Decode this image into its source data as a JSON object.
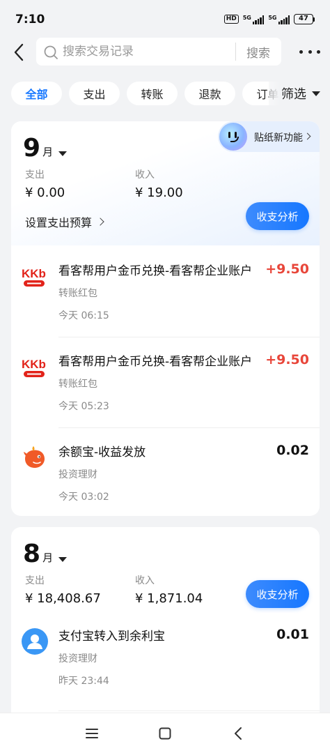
{
  "status_bar": {
    "time": "7:10",
    "hd": "HD",
    "network1": "5G",
    "network2": "5G",
    "battery": "47"
  },
  "search": {
    "placeholder": "搜索交易记录",
    "button": "搜索"
  },
  "filters": {
    "chips": [
      "全部",
      "支出",
      "转账",
      "退款",
      "订单"
    ],
    "active_index": 0,
    "dropdown_label": "筛选"
  },
  "sticker_tag": "贴纸新功能",
  "months": [
    {
      "month": "9",
      "unit": "月",
      "expense_label": "支出",
      "expense_value": "¥ 0.00",
      "income_label": "收入",
      "income_value": "¥ 19.00",
      "budget_link": "设置支出预算",
      "analysis_button": "收支分析",
      "transactions": [
        {
          "icon": "kkb-logo-icon",
          "title": "看客帮用户金币兑换-看客帮企业账户",
          "category": "转账红包",
          "time": "今天 06:15",
          "amount": "+9.50",
          "income": true
        },
        {
          "icon": "kkb-logo-icon",
          "title": "看客帮用户金币兑换-看客帮企业账户",
          "category": "转账红包",
          "time": "今天 05:23",
          "amount": "+9.50",
          "income": true
        },
        {
          "icon": "yuebao-icon",
          "title": "余额宝-收益发放",
          "category": "投资理财",
          "time": "今天 03:02",
          "amount": "0.02",
          "income": false
        }
      ]
    },
    {
      "month": "8",
      "unit": "月",
      "expense_label": "支出",
      "expense_value": "¥ 18,408.67",
      "income_label": "收入",
      "income_value": "¥ 1,871.04",
      "analysis_button": "收支分析",
      "transactions": [
        {
          "icon": "user-avatar-icon",
          "title": "支付宝转入到余利宝",
          "category": "投资理财",
          "time": "昨天 23:44",
          "amount": "0.01",
          "income": false
        }
      ]
    }
  ],
  "colors": {
    "accent": "#1677ff",
    "income": "#e8463a",
    "background": "#f2f3f5"
  }
}
